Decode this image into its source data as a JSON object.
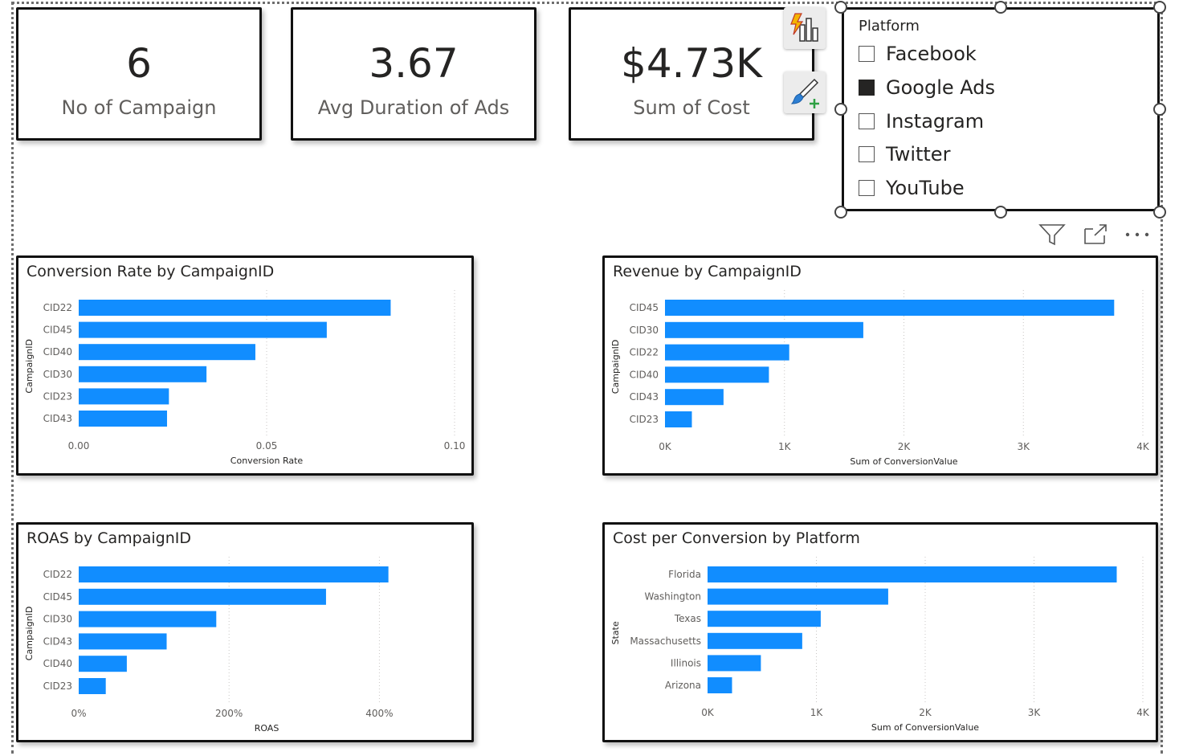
{
  "kpis": [
    {
      "value": "6",
      "label": "No of Campaign"
    },
    {
      "value": "3.67",
      "label": "Avg Duration of Ads"
    },
    {
      "value": "$4.73K",
      "label": "Sum of Cost"
    }
  ],
  "slicer": {
    "title": "Platform",
    "items": [
      {
        "label": "Facebook",
        "checked": false
      },
      {
        "label": "Google Ads",
        "checked": true
      },
      {
        "label": "Instagram",
        "checked": false
      },
      {
        "label": "Twitter",
        "checked": false
      },
      {
        "label": "YouTube",
        "checked": false
      }
    ]
  },
  "visual_toolbar": {
    "icons": [
      "filter-icon",
      "focus-mode-icon",
      "more-options-icon"
    ]
  },
  "floating_buttons": [
    "quick-insights-icon",
    "format-visual-icon"
  ],
  "colors": {
    "bar": "#118dff",
    "gridline": "#c8c6c4"
  },
  "chart_data": [
    {
      "type": "bar",
      "orientation": "horizontal",
      "title": "Conversion Rate by CampaignID",
      "xlabel": "Conversion Rate",
      "ylabel": "CampaignID",
      "categories": [
        "CID22",
        "CID45",
        "CID40",
        "CID30",
        "CID23",
        "CID43"
      ],
      "values": [
        0.083,
        0.066,
        0.047,
        0.034,
        0.024,
        0.0235
      ],
      "xlim": [
        0,
        0.1
      ],
      "xticks": [
        0,
        0.05,
        0.1
      ],
      "xtick_labels": [
        "0.00",
        "0.05",
        "0.10"
      ]
    },
    {
      "type": "bar",
      "orientation": "horizontal",
      "title": "Revenue by CampaignID",
      "xlabel": "Sum of ConversionValue",
      "ylabel": "CampaignID",
      "categories": [
        "CID45",
        "CID30",
        "CID22",
        "CID40",
        "CID43",
        "CID23"
      ],
      "values": [
        3760,
        1660,
        1040,
        870,
        490,
        225
      ],
      "xlim": [
        0,
        4000
      ],
      "xticks": [
        0,
        1000,
        2000,
        3000,
        4000
      ],
      "xtick_labels": [
        "0K",
        "1K",
        "2K",
        "3K",
        "4K"
      ]
    },
    {
      "type": "bar",
      "orientation": "horizontal",
      "title": "ROAS by CampaignID",
      "xlabel": "ROAS",
      "ylabel": "CampaignID",
      "categories": [
        "CID22",
        "CID45",
        "CID30",
        "CID43",
        "CID40",
        "CID23"
      ],
      "values": [
        412,
        329,
        183,
        117,
        64,
        36
      ],
      "xlim": [
        0,
        500
      ],
      "xticks": [
        0,
        200,
        400
      ],
      "xtick_labels": [
        "0%",
        "200%",
        "400%"
      ]
    },
    {
      "type": "bar",
      "orientation": "horizontal",
      "title": "Cost per Conversion by Platform",
      "xlabel": "Sum of ConversionValue",
      "ylabel": "State",
      "categories": [
        "Florida",
        "Washington",
        "Texas",
        "Massachusetts",
        "Illinois",
        "Arizona"
      ],
      "values": [
        3760,
        1660,
        1040,
        870,
        490,
        225
      ],
      "xlim": [
        0,
        4000
      ],
      "xticks": [
        0,
        1000,
        2000,
        3000,
        4000
      ],
      "xtick_labels": [
        "0K",
        "1K",
        "2K",
        "3K",
        "4K"
      ]
    }
  ]
}
